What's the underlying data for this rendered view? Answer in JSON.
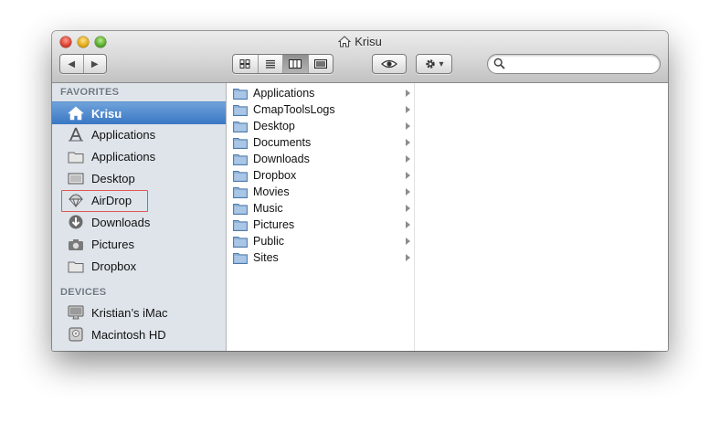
{
  "window": {
    "title": "Krisu"
  },
  "toolbar": {
    "back_label": "◀",
    "forward_label": "▶",
    "action_label": "▾",
    "search": {
      "value": "",
      "placeholder": ""
    }
  },
  "sidebar": {
    "favorites_header": "FAVORITES",
    "devices_header": "DEVICES",
    "favorites": [
      {
        "label": "Krisu",
        "icon": "home-icon"
      },
      {
        "label": "Applications",
        "icon": "applications-icon"
      },
      {
        "label": "Applications",
        "icon": "folder-icon"
      },
      {
        "label": "Desktop",
        "icon": "desktop-icon"
      },
      {
        "label": "AirDrop",
        "icon": "airdrop-icon"
      },
      {
        "label": "Downloads",
        "icon": "downloads-icon"
      },
      {
        "label": "Pictures",
        "icon": "camera-icon"
      },
      {
        "label": "Dropbox",
        "icon": "folder-icon"
      }
    ],
    "devices": [
      {
        "label": "Kristian’s iMac",
        "icon": "imac-icon"
      },
      {
        "label": "Macintosh HD",
        "icon": "hard-drive-icon"
      }
    ]
  },
  "browser": {
    "column1": [
      "Applications",
      "CmapToolsLogs",
      "Desktop",
      "Documents",
      "Downloads",
      "Dropbox",
      "Movies",
      "Music",
      "Pictures",
      "Public",
      "Sites"
    ]
  },
  "colors": {
    "selection": "#3a77c4",
    "sidebar_bg": "#dee4ea",
    "annotation": "#e0574f"
  }
}
